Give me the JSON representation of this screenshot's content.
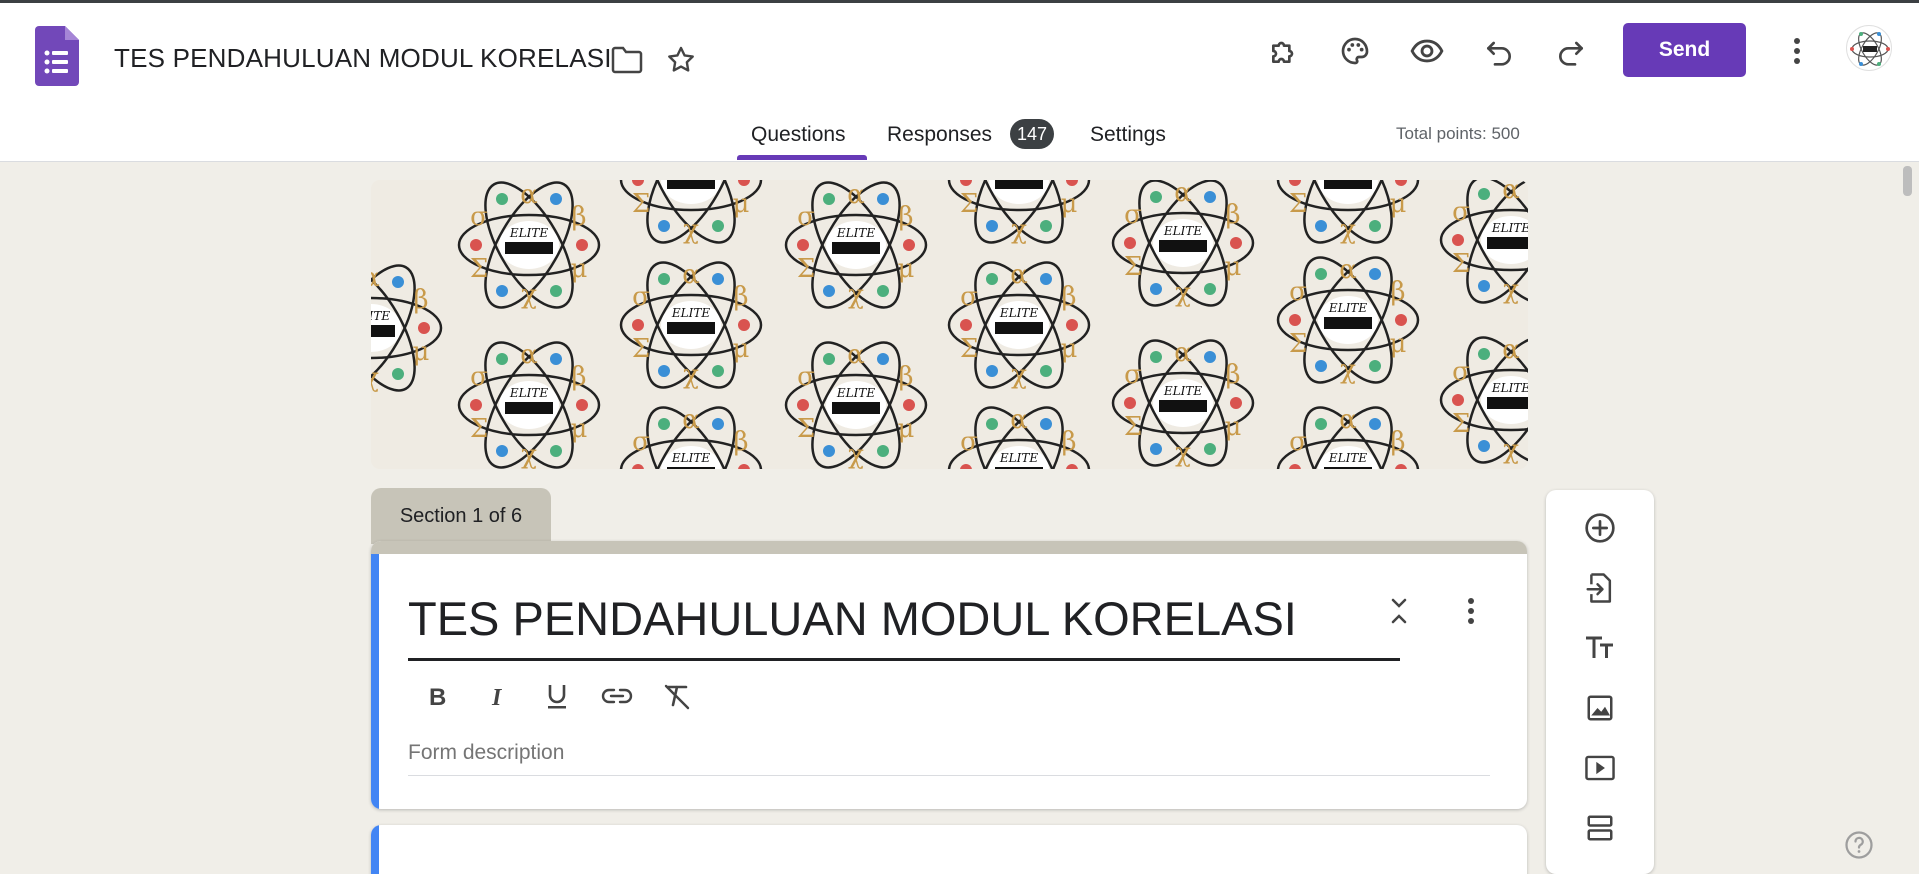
{
  "header": {
    "title": "TES PENDAHULUAN MODUL KORELASI",
    "send_label": "Send",
    "icons": [
      "forms-logo-icon",
      "folder-icon",
      "star-icon",
      "addons-icon",
      "palette-icon",
      "preview-icon",
      "undo-icon",
      "redo-icon",
      "more-vert-icon",
      "avatar"
    ]
  },
  "tabs": {
    "questions": "Questions",
    "responses": "Responses",
    "responses_count": "147",
    "settings": "Settings",
    "active": "Questions"
  },
  "total_points": "Total points: 500",
  "section": {
    "label": "Section 1 of 6",
    "form_title": "TES PENDAHULUAN MODUL KORELASI",
    "description_placeholder": "Form description"
  },
  "header_image_text": "ELITE",
  "colors": {
    "accent": "#673ab7",
    "section_accent": "#4285f4",
    "section_tab": "#c7c4b8",
    "background": "#f0eee8"
  }
}
